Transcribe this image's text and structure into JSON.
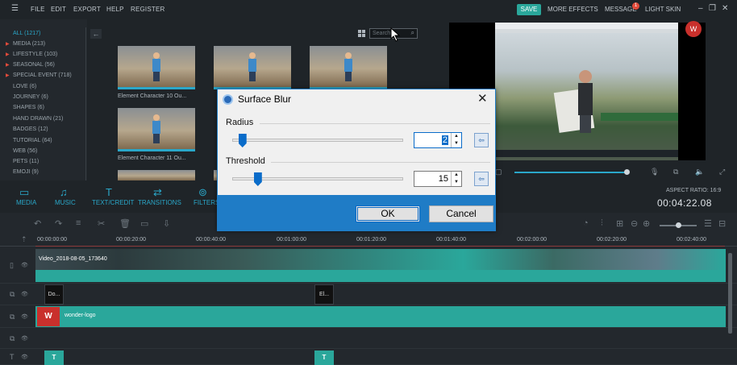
{
  "menu": [
    "FILE",
    "EDIT",
    "EXPORT",
    "HELP",
    "REGISTER"
  ],
  "topbar": {
    "save": "SAVE",
    "more_effects": "MORE EFFECTS",
    "message": "MESSAGE",
    "message_badge": "1",
    "light_skin": "LIGHT SKIN"
  },
  "categories": [
    "ALL (1217)",
    "MEDIA (213)",
    "LIFESTYLE (103)",
    "SEASONAL (56)",
    "SPECIAL EVENT (718)",
    "LOVE (6)",
    "JOURNEY (6)",
    "SHAPES (6)",
    "HAND DRAWN (21)",
    "BADGES (12)",
    "TUTORIAL (64)",
    "WEB (56)",
    "PETS (11)",
    "EMOJI (9)"
  ],
  "search": {
    "placeholder": "Search"
  },
  "media": [
    {
      "label": "Element Character 10 Ou..."
    },
    {
      "label": "Element Character 11 Ou..."
    }
  ],
  "tools": [
    "MEDIA",
    "MUSIC",
    "TEXT/CREDIT",
    "TRANSITIONS",
    "FILTERS"
  ],
  "preview": {
    "aspect": "ASPECT RATIO: 16:9",
    "timecode": "00:04:22.08",
    "logo": "W"
  },
  "ruler": [
    "00:00:00:00",
    "00:00:20:00",
    "00:00:40:00",
    "00:01:00:00",
    "00:01:20:00",
    "00:01:40:00",
    "00:02:00:00",
    "00:02:20:00",
    "00:02:40:00"
  ],
  "timeline": {
    "video_clip": "Video_2018-08-05_173640",
    "clip_a": "Do...",
    "clip_b": "El...",
    "logo_clip": "wonder-logo",
    "logo_glyph": "W",
    "text_clip": "T"
  },
  "dialog": {
    "title": "Surface Blur",
    "radius_label": "Radius",
    "radius_value": "2",
    "radius_level": 0.06,
    "threshold_label": "Threshold",
    "threshold_value": "15",
    "threshold_level": 0.15,
    "ok": "OK",
    "cancel": "Cancel"
  },
  "colors": {
    "accent": "#2aa7c9",
    "teal": "#2aa79b",
    "dialog_blue": "#1f7cc6",
    "badge": "#e24b3b"
  }
}
